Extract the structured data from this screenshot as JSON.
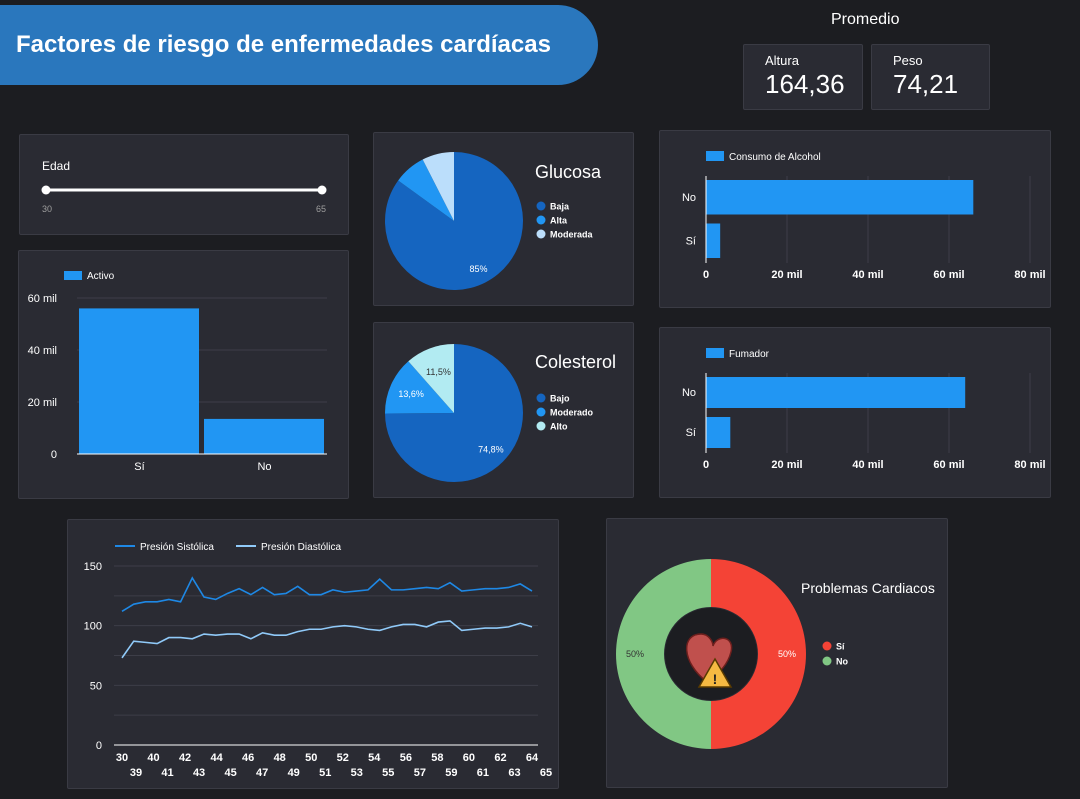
{
  "header": {
    "title": "Factores de riesgo de enfermedades cardíacas"
  },
  "kpis": {
    "heading": "Promedio",
    "items": [
      {
        "label": "Altura",
        "value": "164,36"
      },
      {
        "label": "Peso",
        "value": "74,21"
      }
    ]
  },
  "edad_slider": {
    "label": "Edad",
    "min": "30",
    "max": "65",
    "min_value": 30,
    "max_value": 65
  },
  "colors": {
    "blue_bar": "#2196f3",
    "dark_blue": "#1565c0",
    "mid_blue": "#2196f3",
    "light_blue": "#bbdefb",
    "red": "#f44336",
    "green": "#81c784",
    "title_banner": "#2a77bd"
  },
  "chart_data": [
    {
      "id": "activo",
      "type": "bar",
      "legend": "Activo",
      "categories": [
        "Sí",
        "No"
      ],
      "values": [
        56000,
        13500
      ],
      "ylim": [
        0,
        60000
      ],
      "yticks": [
        "0",
        "20 mil",
        "40 mil",
        "60 mil"
      ]
    },
    {
      "id": "glucosa",
      "type": "pie",
      "title": "Glucosa",
      "labels": [
        "Baja",
        "Alta",
        "Moderada"
      ],
      "values": [
        85,
        7.5,
        7.5
      ],
      "data_labels": [
        "85%",
        "",
        ""
      ],
      "colors": [
        "#1565c0",
        "#2196f3",
        "#bbdefb"
      ]
    },
    {
      "id": "colesterol",
      "type": "pie",
      "title": "Colesterol",
      "labels": [
        "Bajo",
        "Moderado",
        "Alto"
      ],
      "values": [
        74.8,
        13.6,
        11.5
      ],
      "data_labels": [
        "74,8%",
        "13,6%",
        "11,5%"
      ],
      "colors": [
        "#1565c0",
        "#2196f3",
        "#b2ebf2"
      ]
    },
    {
      "id": "alcohol",
      "type": "bar",
      "orientation": "horizontal",
      "legend": "Consumo de Alcohol",
      "categories": [
        "No",
        "Sí"
      ],
      "values": [
        66000,
        3500
      ],
      "xlim": [
        0,
        80000
      ],
      "xticks": [
        "0",
        "20 mil",
        "40 mil",
        "60 mil",
        "80 mil"
      ]
    },
    {
      "id": "fumador",
      "type": "bar",
      "orientation": "horizontal",
      "legend": "Fumador",
      "categories": [
        "No",
        "Sí"
      ],
      "values": [
        64000,
        6000
      ],
      "xlim": [
        0,
        80000
      ],
      "xticks": [
        "0",
        "20 mil",
        "40 mil",
        "60 mil",
        "80 mil"
      ]
    },
    {
      "id": "presion",
      "type": "line",
      "x": [
        30,
        31,
        32,
        33,
        34,
        35,
        36,
        37,
        38,
        39,
        40,
        41,
        42,
        43,
        44,
        45,
        46,
        47,
        48,
        49,
        50,
        51,
        52,
        53,
        54,
        55,
        56,
        57,
        58,
        59,
        60,
        61,
        62,
        63,
        64,
        65
      ],
      "xticks_top": [
        "30",
        "40",
        "42",
        "44",
        "46",
        "48",
        "50",
        "52",
        "54",
        "56",
        "58",
        "60",
        "62",
        "64"
      ],
      "xticks_bottom": [
        "39",
        "41",
        "43",
        "45",
        "47",
        "49",
        "51",
        "53",
        "55",
        "57",
        "59",
        "61",
        "63",
        "65"
      ],
      "ylim": [
        0,
        160
      ],
      "yticks": [
        "0",
        "50",
        "100",
        "150"
      ],
      "series": [
        {
          "name": "Presión Sistólica",
          "color": "#1e88e5",
          "values": [
            112,
            118,
            120,
            120,
            122,
            120,
            140,
            124,
            122,
            127,
            131,
            126,
            132,
            126,
            127,
            133,
            126,
            126,
            130,
            128,
            129,
            130,
            139,
            130,
            130,
            131,
            132,
            131,
            136,
            129,
            130,
            131,
            131,
            132,
            135,
            129
          ]
        },
        {
          "name": "Presión Diastólica",
          "color": "#90caf9",
          "values": [
            73,
            87,
            86,
            85,
            90,
            90,
            89,
            93,
            92,
            93,
            93,
            89,
            94,
            92,
            92,
            95,
            97,
            97,
            99,
            100,
            99,
            97,
            96,
            99,
            101,
            101,
            99,
            103,
            104,
            96,
            97,
            98,
            98,
            99,
            102,
            99
          ]
        }
      ]
    },
    {
      "id": "problemas",
      "type": "pie",
      "title": "Problemas Cardiacos",
      "labels": [
        "Sí",
        "No"
      ],
      "values": [
        50,
        50
      ],
      "data_labels": [
        "50%",
        "50%"
      ],
      "colors": [
        "#f44336",
        "#81c784"
      ]
    }
  ]
}
